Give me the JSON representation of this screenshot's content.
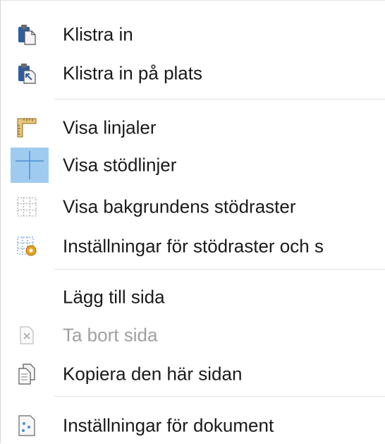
{
  "menu": {
    "items": [
      {
        "label": "Klistra in",
        "icon": "paste-icon",
        "enabled": true
      },
      {
        "label": "Klistra in på plats",
        "icon": "paste-in-place-icon",
        "enabled": true
      },
      {
        "label": "Visa linjaler",
        "icon": "ruler-icon",
        "enabled": true
      },
      {
        "label": "Visa stödlinjer",
        "icon": "guides-icon",
        "enabled": true,
        "checked": true
      },
      {
        "label": "Visa bakgrundens stödraster",
        "icon": "grid-icon",
        "enabled": true
      },
      {
        "label": "Inställningar för stödraster och s",
        "icon": "grid-settings-icon",
        "enabled": true
      },
      {
        "label": "Lägg till sida",
        "icon": "",
        "enabled": true
      },
      {
        "label": "Ta bort sida",
        "icon": "delete-page-icon",
        "enabled": false
      },
      {
        "label": "Kopiera den här sidan",
        "icon": "copy-page-icon",
        "enabled": true
      },
      {
        "label": "Inställningar för dokument",
        "icon": "document-settings-icon",
        "enabled": true
      }
    ]
  },
  "colors": {
    "checked_bg": "#9fcbf0",
    "separator": "#e3e3e3",
    "text": "#1a1a1a",
    "disabled_text": "#a0a0a0"
  }
}
